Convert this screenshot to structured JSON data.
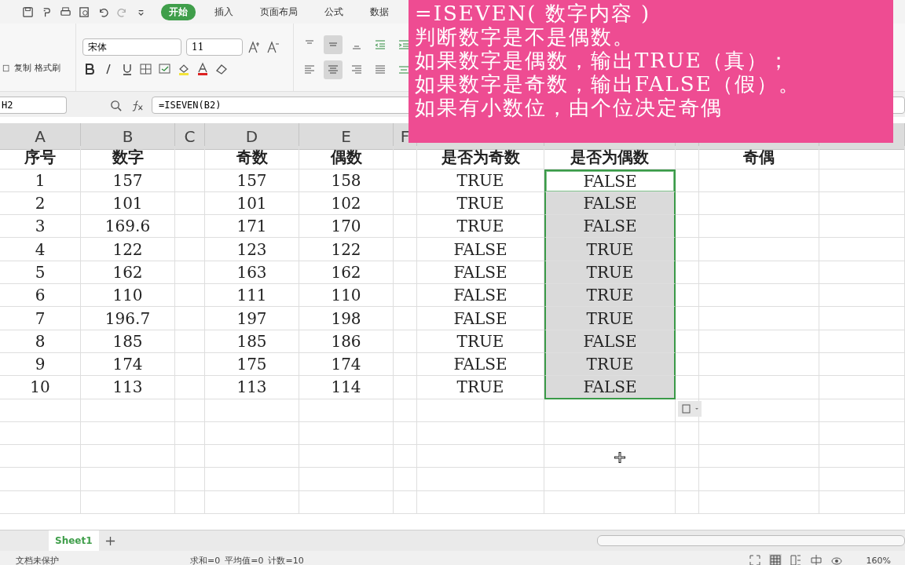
{
  "ribbon_tabs": [
    {
      "label": "开始",
      "selected": true
    },
    {
      "label": "插入",
      "selected": false
    },
    {
      "label": "页面布局",
      "selected": false
    },
    {
      "label": "公式",
      "selected": false
    },
    {
      "label": "数据",
      "selected": false
    }
  ],
  "clipboard": {
    "copy": "复制",
    "format_painter": "格式刷"
  },
  "font": {
    "name": "宋体",
    "size": "11"
  },
  "formula_bar": {
    "name_box": "H2",
    "formula": "=ISEVEN(B2)"
  },
  "column_letters": [
    "A",
    "B",
    "C",
    "D",
    "E",
    "F"
  ],
  "rows": [
    {
      "A": "序号",
      "B": "数字",
      "D": "奇数",
      "E": "偶数",
      "G": "是否为奇数",
      "H": {
        "text": "是否为偶数",
        "selected": false,
        "active": false
      },
      "J": "奇偶"
    },
    {
      "A": "1",
      "B": "157",
      "D": "157",
      "E": "158",
      "G": "TRUE",
      "H": {
        "text": "FALSE",
        "selected": true,
        "active": true
      }
    },
    {
      "A": "2",
      "B": "101",
      "D": "101",
      "E": "102",
      "G": "TRUE",
      "H": {
        "text": "FALSE",
        "selected": true,
        "active": false
      }
    },
    {
      "A": "3",
      "B": "169.6",
      "D": "171",
      "E": "170",
      "G": "TRUE",
      "H": {
        "text": "FALSE",
        "selected": true,
        "active": false
      }
    },
    {
      "A": "4",
      "B": "122",
      "D": "123",
      "E": "122",
      "G": "FALSE",
      "H": {
        "text": "TRUE",
        "selected": true,
        "active": false
      }
    },
    {
      "A": "5",
      "B": "162",
      "D": "163",
      "E": "162",
      "G": "FALSE",
      "H": {
        "text": "TRUE",
        "selected": true,
        "active": false
      }
    },
    {
      "A": "6",
      "B": "110",
      "D": "111",
      "E": "110",
      "G": "FALSE",
      "H": {
        "text": "TRUE",
        "selected": true,
        "active": false
      }
    },
    {
      "A": "7",
      "B": "196.7",
      "D": "197",
      "E": "198",
      "G": "FALSE",
      "H": {
        "text": "TRUE",
        "selected": true,
        "active": false
      }
    },
    {
      "A": "8",
      "B": "185",
      "D": "185",
      "E": "186",
      "G": "TRUE",
      "H": {
        "text": "FALSE",
        "selected": true,
        "active": false
      }
    },
    {
      "A": "9",
      "B": "174",
      "D": "175",
      "E": "174",
      "G": "FALSE",
      "H": {
        "text": "TRUE",
        "selected": true,
        "active": false
      }
    },
    {
      "A": "10",
      "B": "113",
      "D": "113",
      "E": "114",
      "G": "TRUE",
      "H": {
        "text": "FALSE",
        "selected": true,
        "active": false
      }
    }
  ],
  "sheet_tabs": [
    {
      "label": "Sheet1",
      "selected": true
    }
  ],
  "status_bar": {
    "protection": "文档未保护",
    "sum": "求和=0",
    "average": "平均值=0",
    "count": "计数=10",
    "zoom": "160%"
  },
  "note": [
    "=ISEVEN( 数字内容 )",
    "判断数字是不是偶数。",
    "如果数字是偶数，输出TRUE（真）；",
    "如果数字是奇数，输出FALSE（假）。",
    "如果有小数位，由个位决定奇偶"
  ]
}
